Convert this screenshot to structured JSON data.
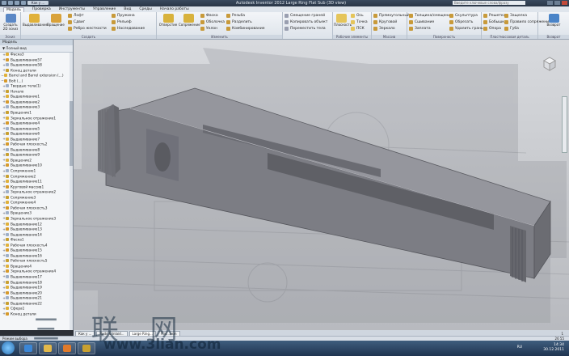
{
  "window": {
    "title": "Autodesk Inventor 2012   Large Ring Flat Sub (3D view)",
    "doc_tab": "Как у ...",
    "search_placeholder": "Введите ключевые слова/фразу"
  },
  "menu": [
    "Модель",
    "Проверка",
    "Инструменты",
    "Управление",
    "Вид",
    "Среды",
    "Начало работы"
  ],
  "ribbon": {
    "groups": {
      "sketch": "Эскиз",
      "create": "Создать",
      "modify": "Изменить",
      "work_features": "Рабочие элементы",
      "pattern": "Массив",
      "surface": "Поверхность",
      "plastic": "Пластмассовая деталь",
      "harness": "Компьютер",
      "convert": "Возврат"
    },
    "buttons": {
      "create_sketch": "Создать 2D эскиз",
      "extrude": "Выдавливание",
      "revolve": "Вращение",
      "loft": "Лофт",
      "sweep": "Сдвиг",
      "rib": "Ребро жесткости",
      "coil": "Пружина",
      "emboss": "Рельеф",
      "derive": "Наследование",
      "hole": "Отверстие",
      "fillet": "Сопряжение",
      "chamfer": "Фаска",
      "shell": "Оболочка",
      "draft": "Уклон",
      "thread": "Резьба",
      "split": "Разделить",
      "combine": "Комбинирование",
      "replace_face": "Смещение граней",
      "copy_object": "Копировать объект",
      "move_bodies": "Переместить тела",
      "plane": "Плоскость",
      "axis": "Ось",
      "point": "Точка",
      "ucs": "ПСК",
      "rect_pattern": "Прямоугольный",
      "circ_pattern": "Круговой",
      "mirror": "Зеркало",
      "thicken": "Толщина/смещение",
      "stitch": "Сшивание",
      "patch": "Заплата",
      "sculpt": "Скульптура",
      "trim": "Обрезать",
      "delete_face": "Удалить грань",
      "grill": "Решетка",
      "boss": "Бобышка",
      "rest": "Опора",
      "snap_fit": "Защелка",
      "rule_fillet": "Правило сопряжения",
      "lip": "Губа",
      "convert_sheet": "Преобразовать в листовой металл",
      "return": "Возврат"
    }
  },
  "browser": {
    "title": "Модель",
    "view_label": "Полный вид",
    "items": [
      "Фаска3",
      "Выдавливание57",
      "Выдавливание58",
      "Конец детали",
      "Barrel and Barrel extension (...)",
      "Bolt (...)",
      "Твердые тела(1)",
      "Начало",
      "Выдавливание1",
      "Выдавливание2",
      "Выдавливание3",
      "Вращение1",
      "Зеркальное отражение1",
      "Выдавливание4",
      "Выдавливание5",
      "Выдавливание6",
      "Выдавливание7",
      "Рабочая плоскость2",
      "Выдавливание8",
      "Выдавливание9",
      "Вращение2",
      "Выдавливание10",
      "Сопряжение1",
      "Сопряжение2",
      "Выдавливание11",
      "Круговой массив1",
      "Зеркальное отражение2",
      "Сопряжение3",
      "Сопряжение4",
      "Рабочая плоскость3",
      "Вращение3",
      "Зеркальное отражение3",
      "Выдавливание12",
      "Выдавливание13",
      "Выдавливание14",
      "Фаска1",
      "Рабочая плоскость4",
      "Выдавливание15",
      "Выдавливание16",
      "Рабочая плоскость5",
      "Вращение4",
      "Зеркальное отражение4",
      "Выдавливание17",
      "Выдавливание18",
      "Выдавливание19",
      "Выдавливание20",
      "Выдавливание21",
      "Выдавливание22",
      "Сфера1",
      "Конец детали"
    ]
  },
  "doc_tabs": [
    "Как у ...",
    "Rods & Inlaid...",
    "Large Ring...",
    "Flat...asm"
  ],
  "page_indicator": "1",
  "status": {
    "left": "Режим выбора",
    "right": "26   55"
  },
  "taskbar": {
    "lang": "RU",
    "time": "14:34",
    "date": "30.12.2011"
  },
  "watermark": {
    "chars": "三 联 网",
    "url": "www.3lian.com"
  },
  "colors": {
    "ribbon_bg": "#e4e9ef",
    "viewport_bg": "#c8cacd",
    "model_gray": "#7e7f86",
    "taskbar": "#2b4666"
  }
}
